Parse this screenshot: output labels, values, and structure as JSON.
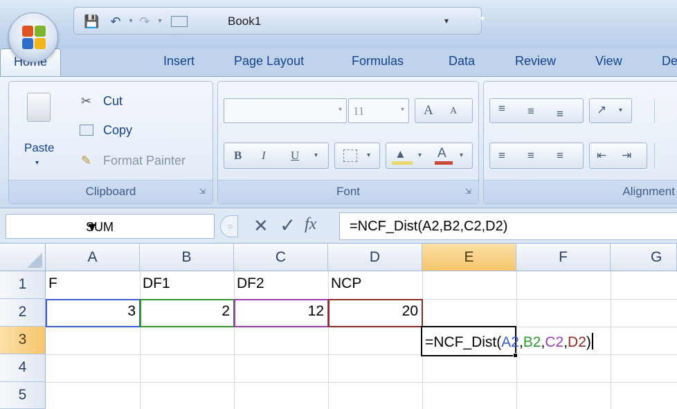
{
  "window": {
    "title": "Book1"
  },
  "tabs": [
    "Home",
    "Insert",
    "Page Layout",
    "Formulas",
    "Data",
    "Review",
    "View",
    "De"
  ],
  "ribbon": {
    "clipboard": {
      "label": "Clipboard",
      "paste": "Paste",
      "cut": "Cut",
      "copy": "Copy",
      "format_painter": "Format Painter"
    },
    "font": {
      "label": "Font",
      "size": "11",
      "bold": "B",
      "italic": "I",
      "underline": "U",
      "grow": "A",
      "shrink": "A"
    },
    "alignment": {
      "label": "Alignment"
    }
  },
  "formula_bar": {
    "name_box": "SUM",
    "formula": "=NCF_Dist(A2,B2,C2,D2)"
  },
  "grid": {
    "columns": [
      "A",
      "B",
      "C",
      "D",
      "E",
      "F",
      "G"
    ],
    "rows": [
      "1",
      "2",
      "3",
      "4",
      "5"
    ],
    "selected_column": "E",
    "selected_row": "3",
    "cells": {
      "A1": "F",
      "B1": "DF1",
      "C1": "DF2",
      "D1": "NCP",
      "A2": "3",
      "B2": "2",
      "C2": "12",
      "D2": "20"
    },
    "edit": {
      "prefix": "=NCF_Dist(",
      "ref_a": "A2",
      "sep1": ",",
      "ref_b": "B2",
      "sep2": ",",
      "ref_c": "C2",
      "sep3": ",",
      "ref_d": "D2",
      "suffix": ")"
    }
  },
  "colors": {
    "ref_a": "#3a5bd1",
    "ref_b": "#2e9a2e",
    "ref_c": "#9b3fb0",
    "ref_d": "#8b2d24",
    "selected_header": "#f7c56b"
  }
}
